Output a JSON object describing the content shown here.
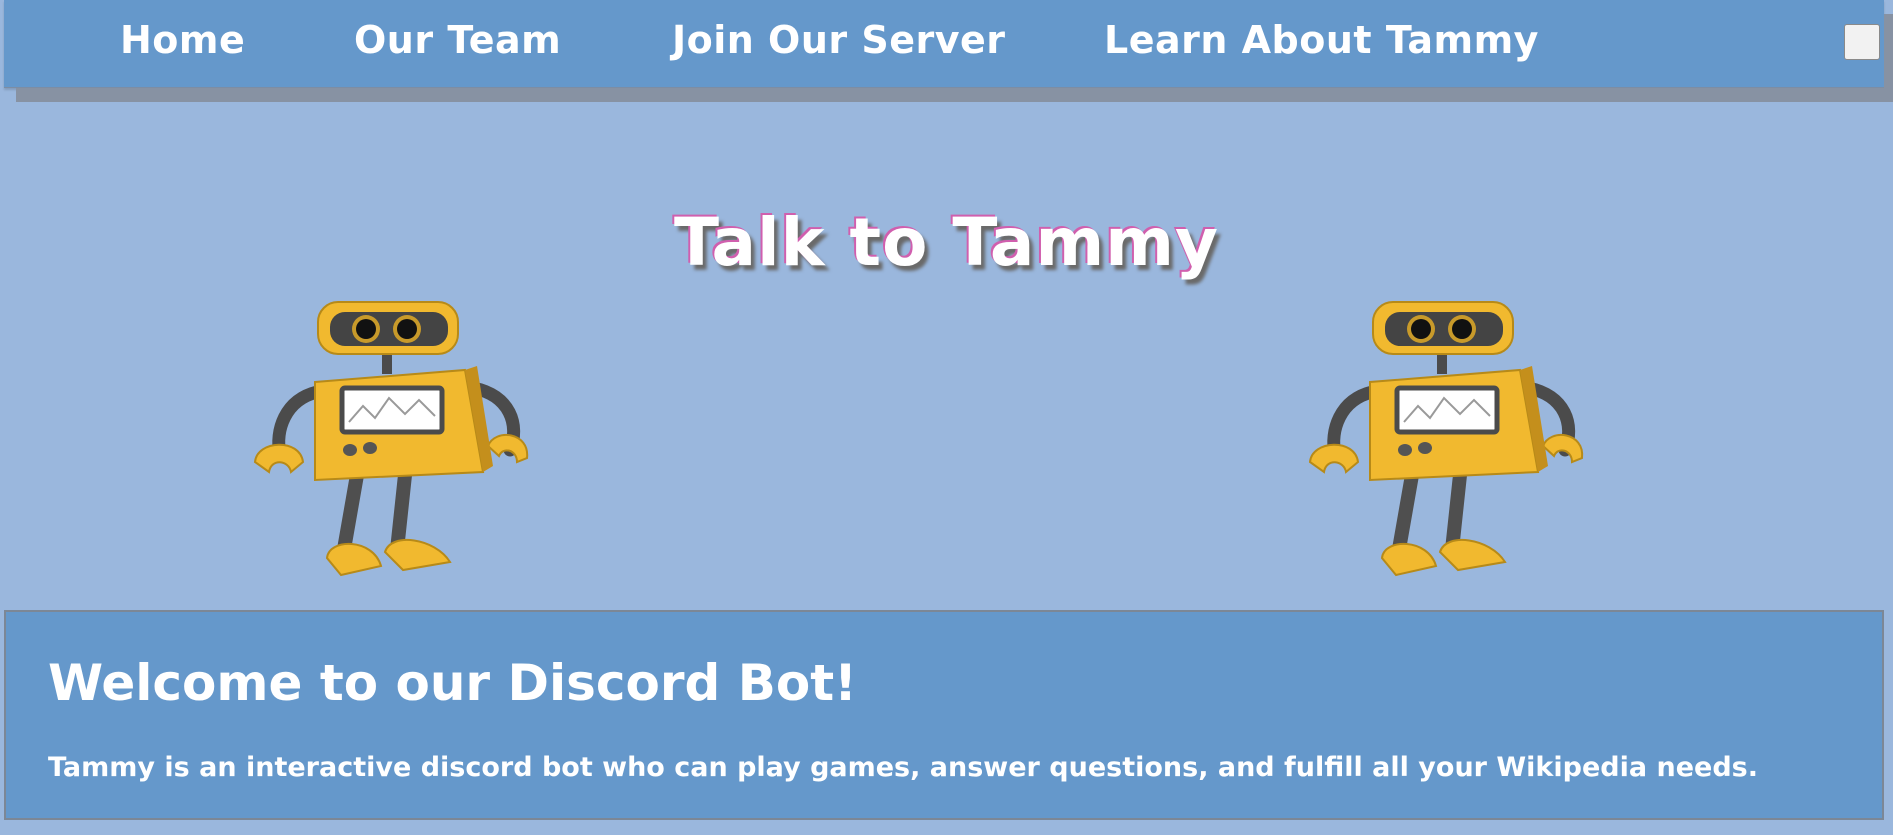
{
  "nav": {
    "items": [
      {
        "label": "Home"
      },
      {
        "label": "Our Team"
      },
      {
        "label": "Join Our Server"
      },
      {
        "label": "Learn About Tammy"
      }
    ]
  },
  "hero": {
    "title": "Talk to Tammy",
    "images": [
      "robot-illustration",
      "robot-illustration"
    ]
  },
  "welcome": {
    "title": "Welcome to our Discord Bot!",
    "text": "Tammy is an interactive discord bot who can play games, answer questions, and fulfill all your Wikipedia needs."
  },
  "colors": {
    "page_background": "#9ab7dd",
    "bar_background": "#6598cb",
    "text": "#ffffff",
    "title_outline": "#d05fae",
    "robot_yellow": "#f1b92f",
    "robot_gray": "#5a5a5a"
  }
}
